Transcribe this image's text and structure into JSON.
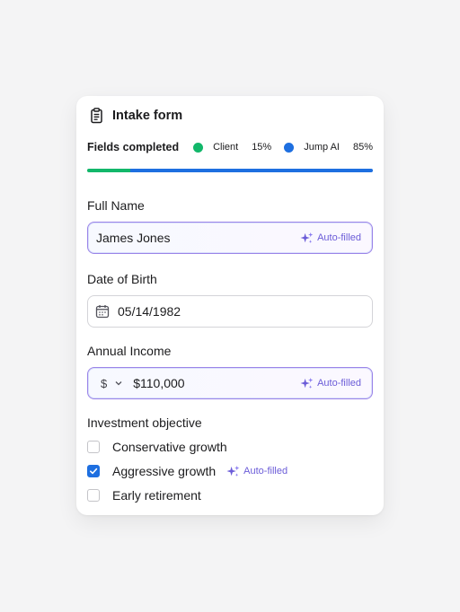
{
  "form": {
    "title": "Intake form",
    "fields_completed_label": "Fields completed",
    "legend": [
      {
        "name": "Client",
        "percent": "15%",
        "color": "#12b76a",
        "fraction": 0.15
      },
      {
        "name": "Jump AI",
        "percent": "85%",
        "color": "#1e6fe0",
        "fraction": 0.85
      }
    ],
    "autofill_label": "Auto-filled",
    "full_name": {
      "label": "Full Name",
      "value": "James Jones"
    },
    "dob": {
      "label": "Date of Birth",
      "value": "05/14/1982"
    },
    "income": {
      "label": "Annual Income",
      "currency": "$",
      "value": "$110,000"
    },
    "objective": {
      "label": "Investment objective",
      "options": [
        {
          "label": "Conservative growth",
          "checked": false
        },
        {
          "label": "Aggressive growth",
          "checked": true
        },
        {
          "label": "Early retirement",
          "checked": false
        }
      ]
    }
  },
  "icons": {
    "title": "clipboard-icon",
    "date": "calendar-icon",
    "autofill": "sparkle-icon",
    "currency": "chevron-down-icon",
    "check": "checkmark-icon"
  },
  "colors": {
    "ai_border": "#9b84e8",
    "ai_text": "#6b5cd8",
    "checkbox": "#1e6fe0",
    "background": "#f4f4f5"
  }
}
